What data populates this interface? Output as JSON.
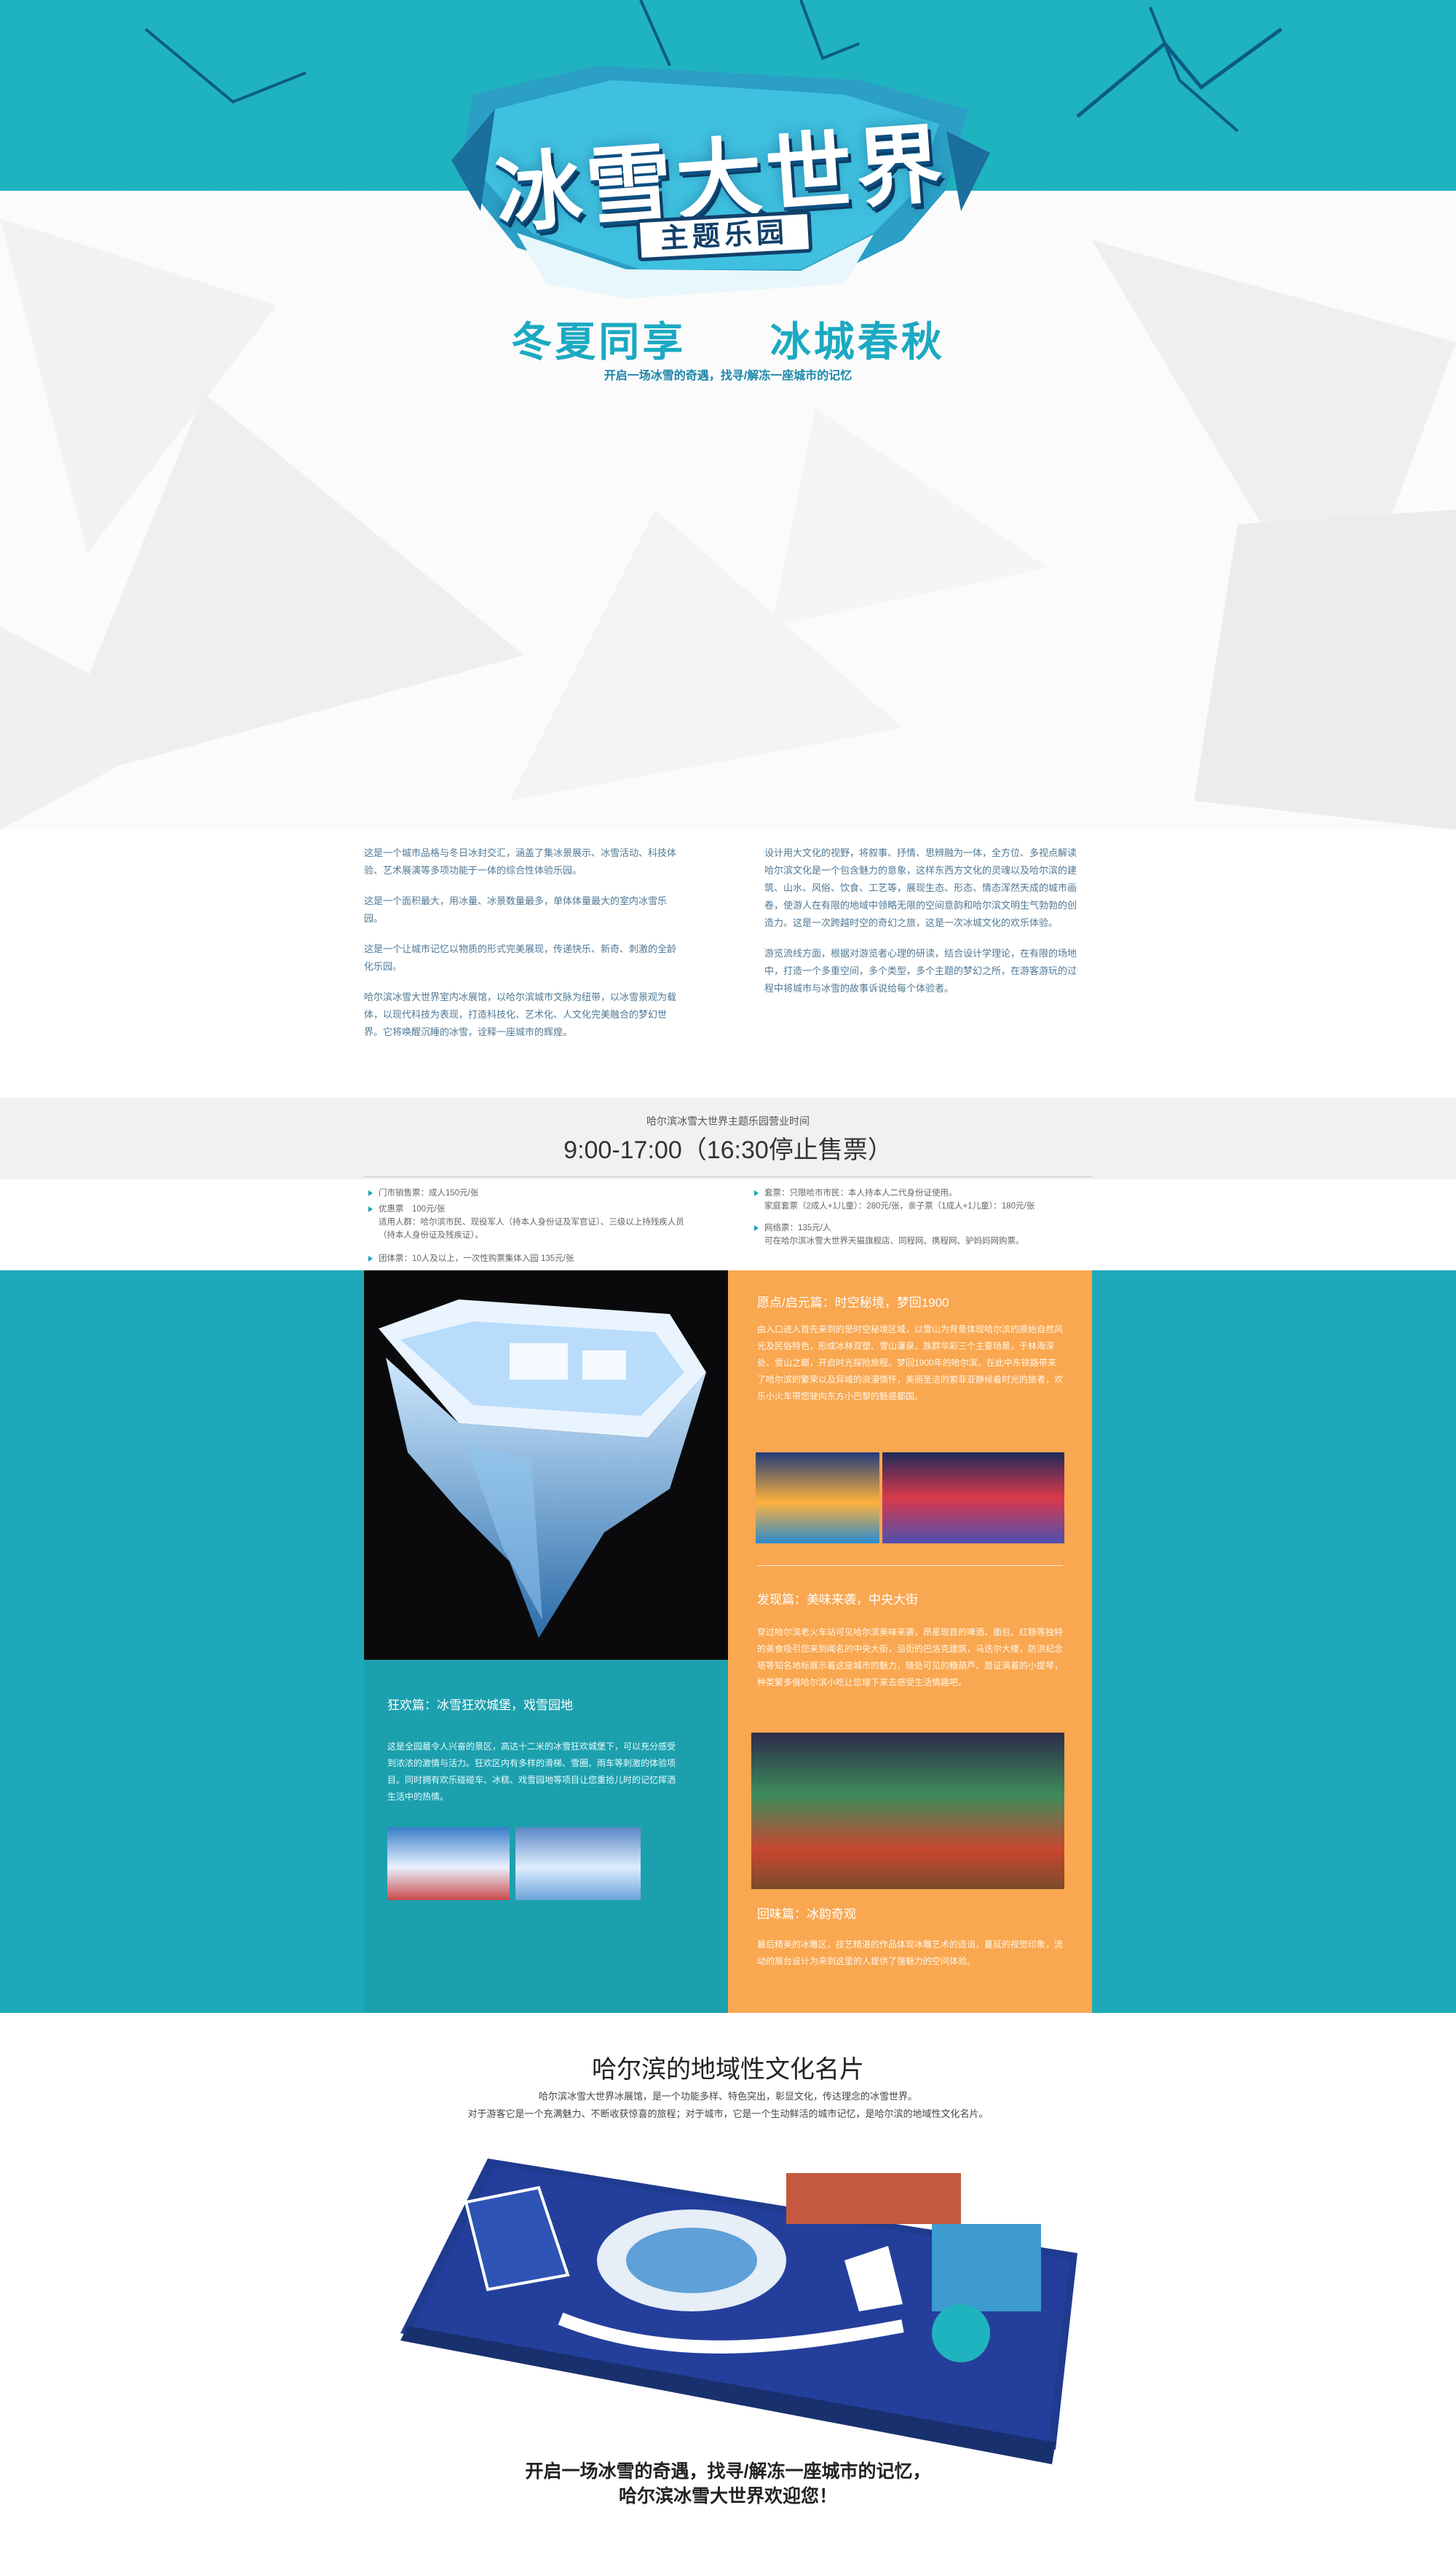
{
  "hero": {
    "logo_title": "冰雪大世界",
    "logo_subtitle": "主题乐园",
    "slogan_left": "冬夏同享",
    "slogan_right": "冰城春秋",
    "subslogan": "开启一场冰雪的奇遇，找寻/解冻一座城市的记忆",
    "colors": {
      "band": "#1fb3bf",
      "slogan": "#1ca9c2"
    }
  },
  "intro": {
    "left": [
      "这是一个城市品格与冬日冰封交汇，涵盖了集冰景展示、冰雪活动、科技体验、艺术展演等多项功能于一体的综合性体验乐园。",
      "这是一个面积最大，用冰量、冰景数量最多，单体体量最大的室内冰雪乐园。",
      "这是一个让城市记忆以物质的形式完美展现，传递快乐、新奇、刺激的全龄化乐园。",
      "哈尔滨冰雪大世界室内冰展馆，以哈尔滨城市文脉为纽带，以冰雪景观为载体，以现代科技为表现，打造科技化、艺术化、人文化完美融合的梦幻世界。它将唤醒沉睡的冰雪，诠释一座城市的辉煌。"
    ],
    "right": [
      "设计用大文化的视野，将叙事、抒情、思辨融为一体，全方位、多视点解读哈尔滨文化是一个包含魅力的意象，这样东西方文化的灵魂以及哈尔滨的建筑、山水、风俗、饮食、工艺等，展现生态、形态、情态浑然天成的城市画卷，使游人在有限的地域中领略无限的空间意韵和哈尔滨文明生气勃勃的创造力。这是一次跨越时空的奇幻之旅，这是一次冰城文化的欢乐体验。",
      "游览流线方面，根据对游览者心理的研读，结合设计学理论，在有限的场地中，打造一个多重空间，多个类型，多个主题的梦幻之所，在游客游玩的过程中将城市与冰雪的故事诉说给每个体验者。"
    ]
  },
  "hours": {
    "label": "哈尔滨冰雪大世界主题乐园营业时间",
    "time": "9:00-17:00（16:30停止售票）"
  },
  "prices": {
    "left": [
      "门市销售票：成人150元/张",
      "优惠票　100元/张",
      "适用人群：哈尔滨市民、现役军人（持本人身份证及军官证）、三级以上持残疾人员（持本人身份证及残疾证）。",
      "团体票：10人及以上，一次性购票集体入园  135元/张"
    ],
    "right": [
      "套票：只限哈市市民：本人持本人二代身份证使用。",
      "家庭套票（2成人+1儿童）：280元/张，亲子票（1成人+1儿童）：180元/张",
      "网络票：135元/人",
      "可在哈尔滨冰雪大世界天猫旗舰店、同程网、携程网、驴妈妈网购票。"
    ]
  },
  "zones": {
    "colors": {
      "teal": "#1da9b9",
      "orange": "#f9a750"
    },
    "left": {
      "title": "狂欢篇：冰雪狂欢城堡，戏雪园地",
      "text": "这是全园最令人兴奋的景区，高达十二米的冰雪狂欢城堡下，可以充分感受到浓浓的激情与活力。狂欢区内有多样的滑梯、雪圈、雨车等刺激的体验项目。同时拥有欢乐碰碰车、冰糕、戏雪园地等项目让您重拾儿时的记忆挥洒生活中的热情。"
    },
    "right": [
      {
        "title": "愿点/启元篇：时空秘境，梦回1900",
        "text": "由入口进入首先来到的是时空秘境区域，以雪山为背景体现哈尔滨的原始自然风光及民俗特色，形成冰林双塑、雪山瀑泉、族群华彩三个主要场景，于林海深处、雪山之巅，开启时光探险旅程。梦回1900年的哈尔滨，在此中东铁路带来了哈尔滨的繁荣以及异域的浪漫情怀，美丽圣洁的索菲亚静候着时光的旅者，欢乐小火车带您驶向东方小巴黎的魅惑都国。"
      },
      {
        "title": "发现篇：美味来袭，中央大街",
        "text": "穿过哈尔滨老火车站可见哈尔滨美味来袭，昂星现首的啤酒、面包、红肠等独特的美食吸引您来到闻名的中央大街，沿街的巴洛克建筑，马迭尔大楼，防洪纪念塔等知名地标展示着这座城市的魅力，随处可见的糖葫芦、唇证满着的小提琴，种类繁多俄哈尔滨小吃让您增下来去感受生活情趣吧。"
      },
      {
        "title": "回味篇：冰韵奇观",
        "text": "最后精美的冰雕区，技艺精湛的作品体现冰雕艺术的造诣，蔓延的视觉印象，流动的展台设计为来到这里的人提供了强魅力的空间体验。"
      }
    ]
  },
  "culture": {
    "title": "哈尔滨的地域性文化名片",
    "lines": [
      "哈尔滨冰雪大世界冰展馆，是一个功能多样、特色突出，彰显文化，传达理念的冰雪世界。",
      "对于游客它是一个充满魅力、不断收获惊喜的旅程；对于城市，它是一个生动鲜活的城市记忆，是哈尔滨的地域性文化名片。"
    ],
    "closing": [
      "开启一场冰雪的奇遇，找寻/解冻一座城市的记忆，",
      "哈尔滨冰雪大世界欢迎您！"
    ]
  }
}
